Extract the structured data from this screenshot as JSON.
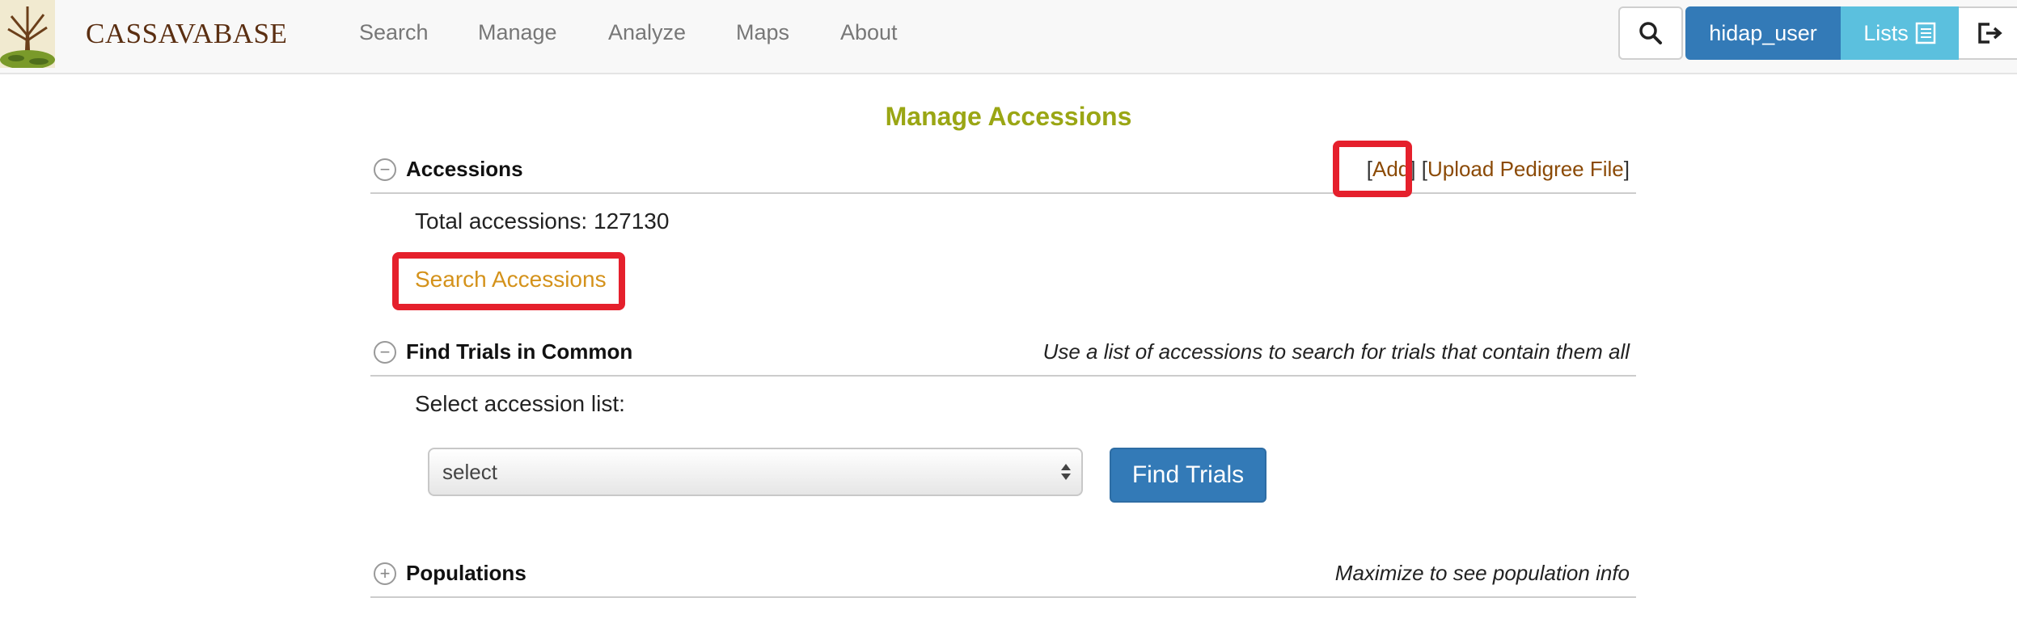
{
  "navbar": {
    "brand": "CASSAVABASE",
    "items": [
      {
        "label": "Search"
      },
      {
        "label": "Manage"
      },
      {
        "label": "Analyze"
      },
      {
        "label": "Maps"
      },
      {
        "label": "About"
      }
    ],
    "user_button": "hidap_user",
    "lists_button": "Lists",
    "icons": {
      "search": "search-icon",
      "lists": "list-icon",
      "logout": "logout-icon"
    }
  },
  "page": {
    "title": "Manage Accessions"
  },
  "accessions_section": {
    "title": "Accessions",
    "links": {
      "add": "Add",
      "upload_pedigree": "Upload Pedigree File"
    },
    "total_label": "Total accessions: 127130",
    "search_link": "Search Accessions"
  },
  "trials_section": {
    "title": "Find Trials in Common",
    "hint": "Use a list of accessions to search for trials that contain them all",
    "select_label": "Select accession list:",
    "select_value": "select",
    "find_button": "Find Trials"
  },
  "populations_section": {
    "title": "Populations",
    "hint": "Maximize to see population info"
  },
  "colors": {
    "brand": "#5b2f12",
    "title": "#9aa614",
    "primary": "#337ab7",
    "info": "#5bc0de",
    "link": "#8b4a06",
    "search_link": "#d4921b",
    "highlight": "#e5202c"
  }
}
